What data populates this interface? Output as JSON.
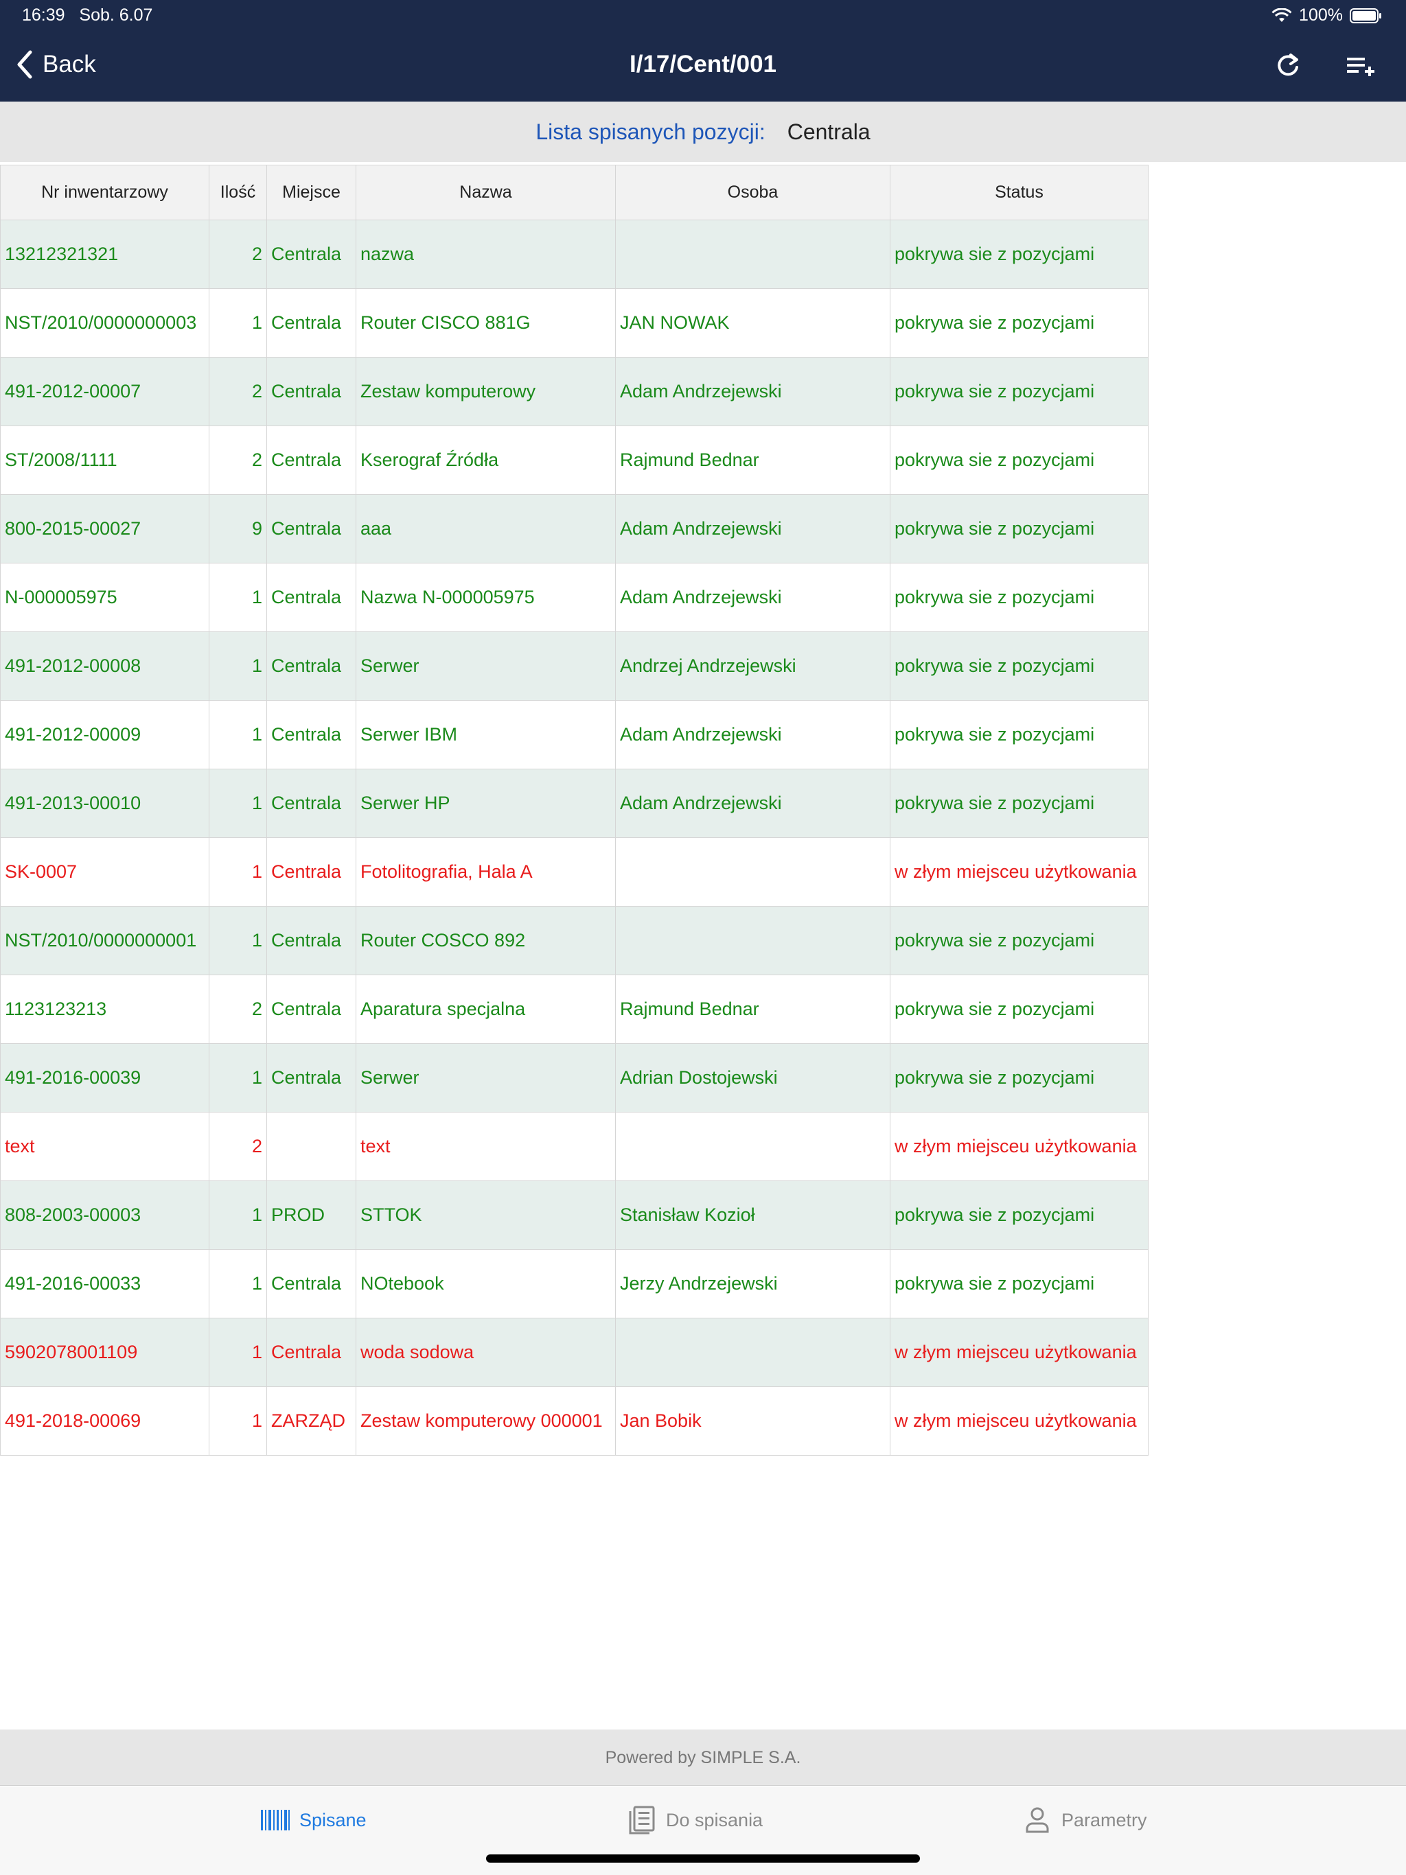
{
  "status": {
    "time": "16:39",
    "date": "Sob. 6.07",
    "battery": "100%"
  },
  "nav": {
    "back_label": "Back",
    "title": "I/17/Cent/001"
  },
  "subheader": {
    "label": "Lista spisanych pozycji:",
    "value": "Centrala"
  },
  "table": {
    "headers": [
      "Nr inwentarzowy",
      "Ilość",
      "Miejsce",
      "Nazwa",
      "Osoba",
      "Status"
    ],
    "rows": [
      {
        "nr": "13212321321",
        "ilosc": "2",
        "miejsce": "Centrala",
        "nazwa": "nazwa",
        "osoba": "",
        "status": "pokrywa sie z pozycjami",
        "state": "ok"
      },
      {
        "nr": "NST/2010/0000000003",
        "ilosc": "1",
        "miejsce": "Centrala",
        "nazwa": "Router CISCO 881G",
        "osoba": "JAN NOWAK",
        "status": "pokrywa sie z pozycjami",
        "state": "ok"
      },
      {
        "nr": "491-2012-00007",
        "ilosc": "2",
        "miejsce": "Centrala",
        "nazwa": "Zestaw komputerowy",
        "osoba": "Adam Andrzejewski",
        "status": "pokrywa sie z pozycjami",
        "state": "ok"
      },
      {
        "nr": "ST/2008/1111",
        "ilosc": "2",
        "miejsce": "Centrala",
        "nazwa": "Kserograf Źródła",
        "osoba": "Rajmund Bednar",
        "status": "pokrywa sie z pozycjami",
        "state": "ok"
      },
      {
        "nr": "800-2015-00027",
        "ilosc": "9",
        "miejsce": "Centrala",
        "nazwa": "aaa",
        "osoba": "Adam Andrzejewski",
        "status": "pokrywa sie z pozycjami",
        "state": "ok"
      },
      {
        "nr": "N-000005975",
        "ilosc": "1",
        "miejsce": "Centrala",
        "nazwa": "Nazwa N-000005975",
        "osoba": "Adam Andrzejewski",
        "status": "pokrywa sie z pozycjami",
        "state": "ok"
      },
      {
        "nr": "491-2012-00008",
        "ilosc": "1",
        "miejsce": "Centrala",
        "nazwa": "Serwer",
        "osoba": "Andrzej Andrzejewski",
        "status": "pokrywa sie z pozycjami",
        "state": "ok"
      },
      {
        "nr": "491-2012-00009",
        "ilosc": "1",
        "miejsce": "Centrala",
        "nazwa": "Serwer IBM",
        "osoba": "Adam Andrzejewski",
        "status": "pokrywa sie z pozycjami",
        "state": "ok"
      },
      {
        "nr": "491-2013-00010",
        "ilosc": "1",
        "miejsce": "Centrala",
        "nazwa": "Serwer HP",
        "osoba": "Adam Andrzejewski",
        "status": "pokrywa sie z pozycjami",
        "state": "ok"
      },
      {
        "nr": "SK-0007",
        "ilosc": "1",
        "miejsce": "Centrala",
        "nazwa": "Fotolitografia, Hala A",
        "osoba": "",
        "status": "w złym miejsceu użytkowania",
        "state": "bad"
      },
      {
        "nr": "NST/2010/0000000001",
        "ilosc": "1",
        "miejsce": "Centrala",
        "nazwa": "Router COSCO 892",
        "osoba": "",
        "status": "pokrywa sie z pozycjami",
        "state": "ok"
      },
      {
        "nr": "1123123213",
        "ilosc": "2",
        "miejsce": "Centrala",
        "nazwa": "Aparatura specjalna",
        "osoba": "Rajmund Bednar",
        "status": "pokrywa sie z pozycjami",
        "state": "ok"
      },
      {
        "nr": "491-2016-00039",
        "ilosc": "1",
        "miejsce": "Centrala",
        "nazwa": "Serwer",
        "osoba": "Adrian Dostojewski",
        "status": "pokrywa sie z pozycjami",
        "state": "ok"
      },
      {
        "nr": "text",
        "ilosc": "2",
        "miejsce": "",
        "nazwa": "text",
        "osoba": "",
        "status": "w złym miejsceu użytkowania",
        "state": "bad"
      },
      {
        "nr": "808-2003-00003",
        "ilosc": "1",
        "miejsce": "PROD",
        "nazwa": "STTOK",
        "osoba": "Stanisław Kozioł",
        "status": "pokrywa sie z pozycjami",
        "state": "ok"
      },
      {
        "nr": "491-2016-00033",
        "ilosc": "1",
        "miejsce": "Centrala",
        "nazwa": "NOtebook",
        "osoba": "Jerzy Andrzejewski",
        "status": "pokrywa sie z pozycjami",
        "state": "ok"
      },
      {
        "nr": "5902078001109",
        "ilosc": "1",
        "miejsce": "Centrala",
        "nazwa": " woda sodowa",
        "osoba": "",
        "status": "w złym miejsceu użytkowania",
        "state": "bad"
      },
      {
        "nr": "491-2018-00069",
        "ilosc": "1",
        "miejsce": "ZARZĄD",
        "nazwa": "Zestaw komputerowy 000001",
        "osoba": "Jan Bobik",
        "status": "w złym miejsceu użytkowania",
        "state": "bad"
      }
    ]
  },
  "footer": {
    "powered": "Powered by SIMPLE S.A."
  },
  "tabs": [
    {
      "label": "Spisane",
      "icon": "barcode-icon",
      "active": true
    },
    {
      "label": "Do spisania",
      "icon": "document-list-icon",
      "active": false
    },
    {
      "label": "Parametry",
      "icon": "person-icon",
      "active": false
    }
  ],
  "colors": {
    "nav_bg": "#1c2a4a",
    "ok_text": "#1a8a1a",
    "bad_text": "#e81c1c",
    "accent": "#1f7ae0",
    "row_shade": "#e6efec"
  }
}
